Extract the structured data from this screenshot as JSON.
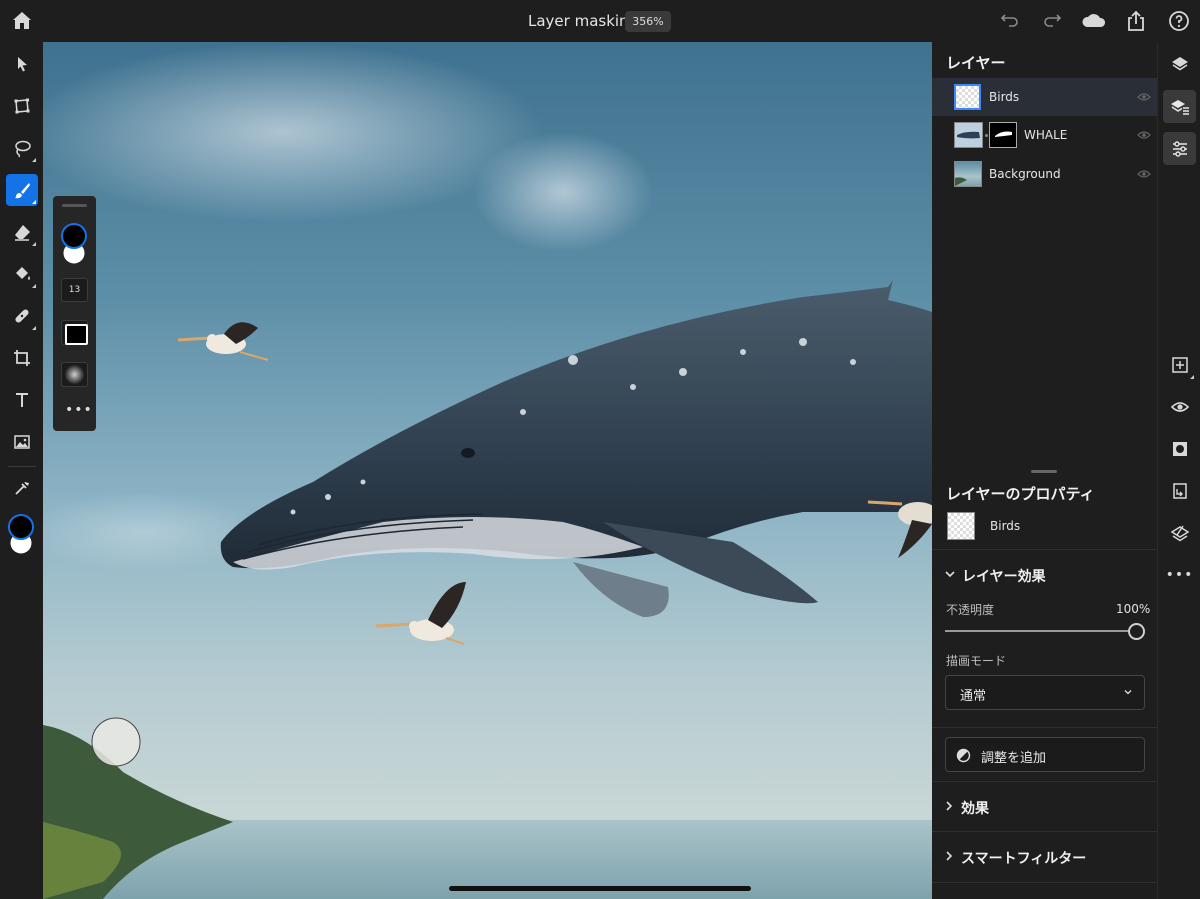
{
  "header": {
    "doc_title": "Layer masking",
    "zoom": "356%"
  },
  "toolbar": {
    "tools": [
      "select-icon",
      "transform-icon",
      "lasso-icon",
      "brush-icon",
      "eraser-icon",
      "fill-icon",
      "healing-icon",
      "crop-icon",
      "type-icon",
      "place-image-icon",
      "eyedropper-icon"
    ],
    "active_tool": "brush-icon",
    "foreground_color": "#000000",
    "background_color": "#ffffff"
  },
  "brush_panel": {
    "size": "13"
  },
  "layers_panel": {
    "title": "レイヤー",
    "layers": [
      {
        "name": "Birds",
        "selected": true
      },
      {
        "name": "WHALE",
        "selected": false
      },
      {
        "name": "Background",
        "selected": false
      }
    ]
  },
  "properties": {
    "title": "レイヤーのプロパティ",
    "layer_name": "Birds",
    "effects_section": "レイヤー効果",
    "opacity_label": "不透明度",
    "opacity_value": "100%",
    "opacity_fraction": 1.0,
    "blend_label": "描画モード",
    "blend_value": "通常",
    "add_adjustment": "調整を追加",
    "fx_section": "効果",
    "smart_filter_section": "スマートフィルター"
  },
  "colors": {
    "accent": "#1473e6",
    "panel_bg": "#1e1e1e",
    "selected_row": "#2a2f37"
  }
}
